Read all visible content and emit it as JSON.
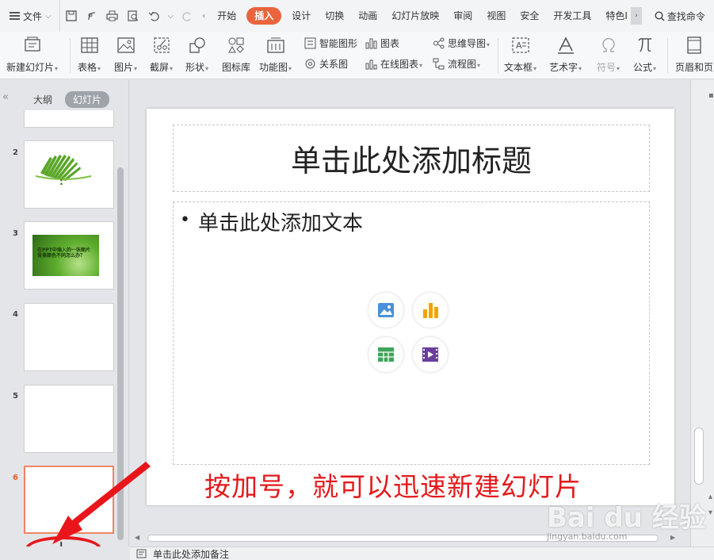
{
  "topbar": {
    "file_label": "文件",
    "tabs": [
      "开始",
      "插入",
      "设计",
      "切换",
      "动画",
      "幻灯片放映",
      "审阅",
      "视图",
      "安全",
      "开发工具",
      "特色I"
    ],
    "active_tab_index": 1,
    "search_label": "查找命令"
  },
  "ribbon": {
    "new_slide": "新建幻灯片",
    "table": "表格",
    "picture": "图片",
    "screenshot": "截屏",
    "shape": "形状",
    "icon_lib": "图标库",
    "func_chart": "功能图",
    "smart_shape": "智能图形",
    "chart": "图表",
    "mindmap": "思维导图",
    "relation": "关系图",
    "online_chart": "在线图表",
    "flowchart": "流程图",
    "textbox": "文本框",
    "wordart": "艺术字",
    "symbol": "符号",
    "formula": "公式",
    "header_footer": "页眉和页"
  },
  "leftpanel": {
    "outline_tab": "大纲",
    "slides_tab": "幻灯片",
    "slide_numbers": [
      "2",
      "3",
      "4",
      "5",
      "6"
    ],
    "slide2_text": ":",
    "slide3_text": "在PPT中插入的一张图片背景颜色不同怎么办？",
    "add_symbol": "+"
  },
  "slide": {
    "title_placeholder": "单击此处添加标题",
    "body_placeholder": "单击此处添加文本",
    "annotation": "按加号，就可以迅速新建幻灯片"
  },
  "notes": {
    "placeholder": "单击此处添加备注"
  },
  "watermark": {
    "brand": "Bai du 经验",
    "url": "jingyan.baidu.com"
  },
  "colors": {
    "accent": "#e9643c",
    "annotation_red": "#e5191b",
    "selected_border": "#f08565"
  }
}
